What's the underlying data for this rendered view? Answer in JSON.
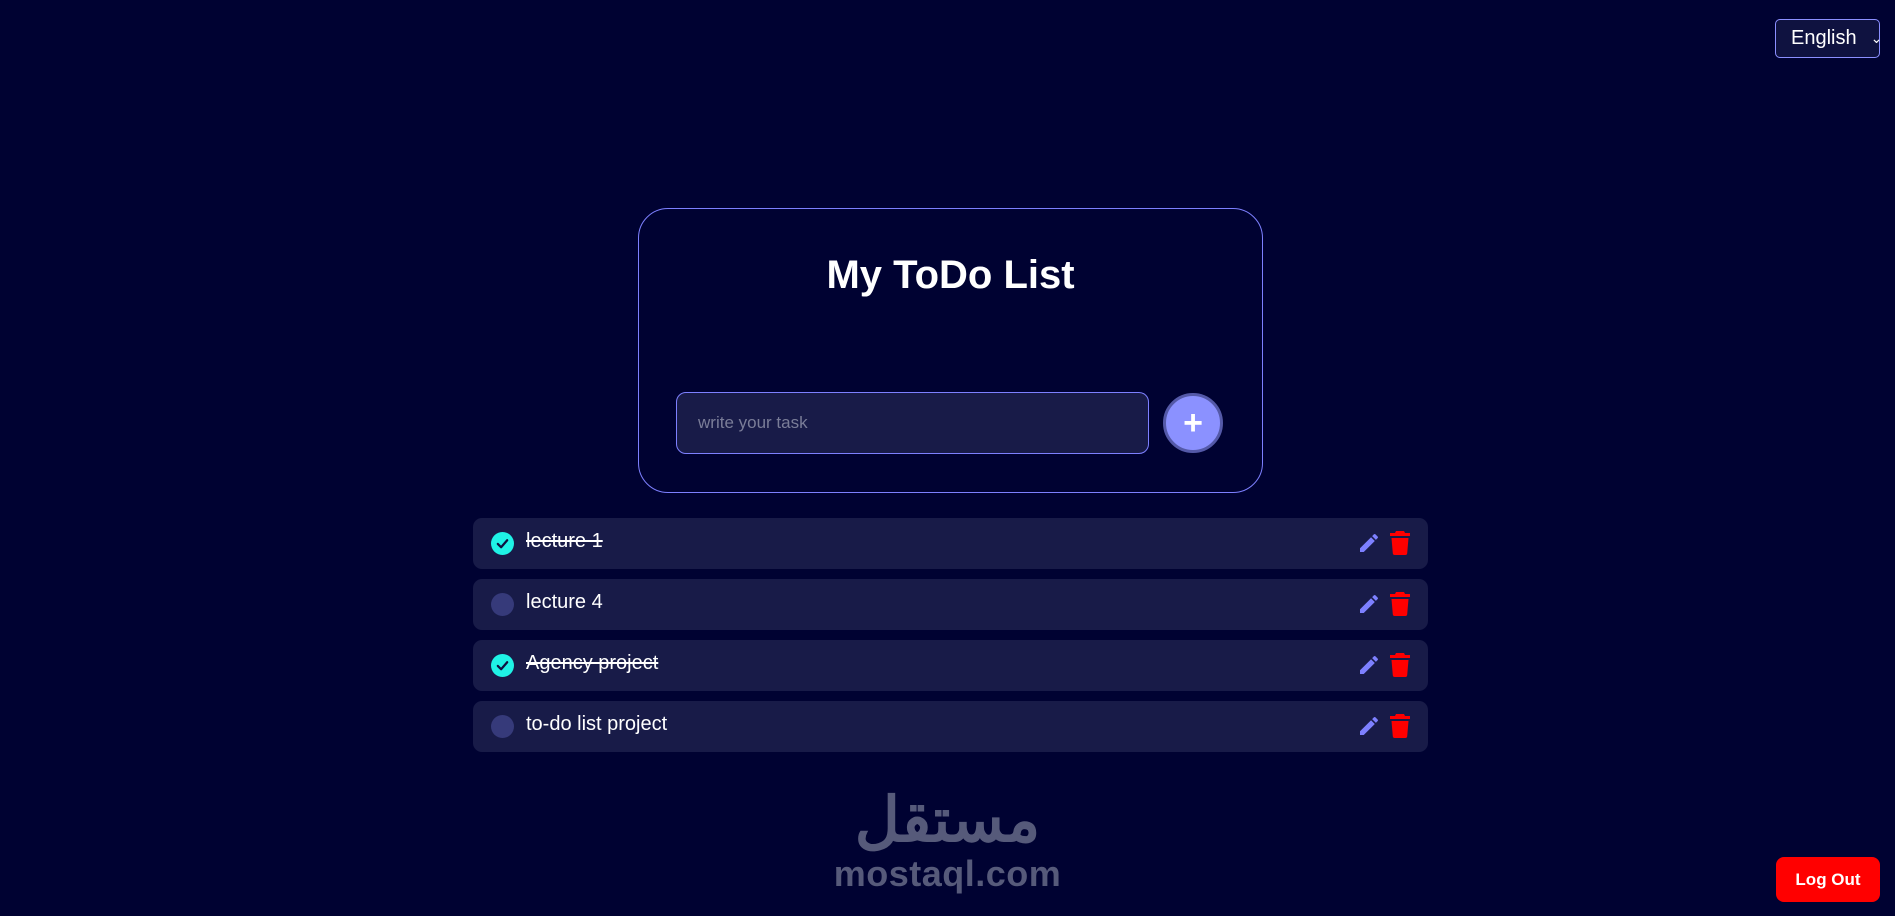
{
  "language": {
    "selected": "English"
  },
  "card": {
    "title": "My ToDo List",
    "input": {
      "value": "",
      "placeholder": "write your task"
    },
    "add_label": "+"
  },
  "tasks": [
    {
      "text": "lecture 1",
      "done": true
    },
    {
      "text": "lecture 4",
      "done": false
    },
    {
      "text": "Agency project",
      "done": true
    },
    {
      "text": "to-do list project",
      "done": false
    }
  ],
  "watermark": {
    "arabic": "مستقل",
    "latin": "mostaql.com"
  },
  "logout_label": "Log Out",
  "colors": {
    "background": "#000232",
    "card_border": "#7d80ff",
    "row_background": "#181b48",
    "check_done": "#1ff2e6",
    "check_todo": "#363a7a",
    "edit_icon": "#7d80ff",
    "delete_icon": "#ff0000",
    "add_button": "#8b91ff",
    "logout": "#ff0000"
  },
  "icons": {
    "check": "check-circle-icon",
    "unchecked": "circle-icon",
    "edit": "pencil-icon",
    "delete": "trash-icon",
    "add": "plus-icon",
    "dropdown": "chevron-down-icon"
  }
}
